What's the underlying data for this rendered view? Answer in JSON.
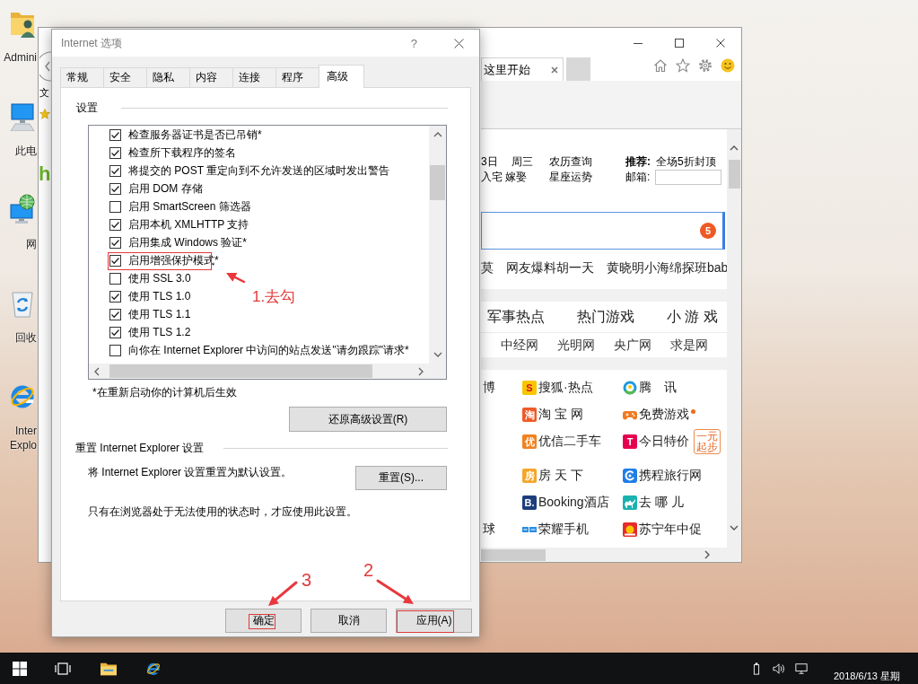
{
  "desktop": {
    "icons": [
      {
        "kind": "user-folder",
        "label": "Admini"
      },
      {
        "kind": "computer",
        "label": "此电"
      },
      {
        "kind": "network",
        "label": "网"
      },
      {
        "kind": "recycle-bin",
        "label": "回收"
      },
      {
        "kind": "browser",
        "label": "Inter Explo"
      }
    ]
  },
  "browser": {
    "menu_fragment": "文",
    "logo_fragment": "h",
    "tabs": [
      {
        "label": "这里开始",
        "selected": true
      }
    ],
    "info": {
      "date": "3日",
      "weekday": "周三",
      "lunar": "农历查询",
      "almanac": "入宅 嫁娶",
      "horoscope": "星座运势",
      "recommend_label": "推荐:",
      "recommend": "全场5折封顶",
      "mail_label": "邮箱:"
    },
    "search": {
      "badge": "5"
    },
    "hot_searches": [
      "莫",
      "网友爆料胡一天",
      "黄晓明小海绵探班bab"
    ],
    "categories": [
      "军事热点",
      "热门游戏",
      "小 游 戏"
    ],
    "media_links": [
      "中经网",
      "光明网",
      "央广网",
      "求是网"
    ],
    "site_rows": [
      {
        "fragment": "博",
        "items": [
          {
            "kind": "sohu",
            "icon_text": "S",
            "label": "搜狐·热点",
            "dot": false
          },
          {
            "kind": "tencent",
            "label": "腾　讯",
            "dot": false
          }
        ]
      },
      {
        "items": [
          {
            "kind": "taobao",
            "icon_text": "淘",
            "label": "淘 宝 网",
            "dot": false
          },
          {
            "kind": "game",
            "label": "免费游戏",
            "dot": true
          }
        ]
      },
      {
        "items": [
          {
            "kind": "youxin",
            "icon_text": "优",
            "label": "优信二手车",
            "dot": false
          },
          {
            "kind": "tmall",
            "icon_text": "T",
            "label": "今日特价",
            "badge": "一元起步",
            "dot": false
          }
        ]
      },
      {
        "items": [
          {
            "kind": "fang",
            "icon_text": "房",
            "label": "房 天 下",
            "dot": false
          },
          {
            "kind": "ctrip",
            "label": "携程旅行网",
            "dot": false
          }
        ]
      },
      {
        "items": [
          {
            "kind": "booking",
            "icon_text": "B.",
            "label": "Booking酒店",
            "dot": false
          },
          {
            "kind": "qunar",
            "label": "去 哪 儿",
            "dot": false
          }
        ]
      },
      {
        "fragment": "球",
        "items": [
          {
            "kind": "honor",
            "label": "荣耀手机",
            "dot": false
          },
          {
            "kind": "suning",
            "label": "苏宁年中促",
            "dot": false
          }
        ]
      }
    ]
  },
  "dialog": {
    "title": "Internet 选项",
    "help": "?",
    "tabs": [
      {
        "label": "常规",
        "selected": false
      },
      {
        "label": "安全",
        "selected": false
      },
      {
        "label": "隐私",
        "selected": false
      },
      {
        "label": "内容",
        "selected": false
      },
      {
        "label": "连接",
        "selected": false
      },
      {
        "label": "程序",
        "selected": false
      },
      {
        "label": "高级",
        "selected": true
      }
    ],
    "settings_group": "设置",
    "options": [
      {
        "label": "检查服务器证书是否已吊销*",
        "checked": true,
        "highlighted": false
      },
      {
        "label": "检查所下载程序的签名",
        "checked": true,
        "highlighted": false
      },
      {
        "label": "将提交的 POST 重定向到不允许发送的区域时发出警告",
        "checked": true,
        "highlighted": false
      },
      {
        "label": "启用 DOM 存储",
        "checked": true,
        "highlighted": false
      },
      {
        "label": "启用 SmartScreen 筛选器",
        "checked": false,
        "highlighted": false
      },
      {
        "label": "启用本机 XMLHTTP 支持",
        "checked": true,
        "highlighted": false
      },
      {
        "label": "启用集成 Windows 验证*",
        "checked": true,
        "highlighted": false
      },
      {
        "label": "启用增强保护模式*",
        "checked": true,
        "highlighted": true
      },
      {
        "label": "使用 SSL 3.0",
        "checked": false,
        "highlighted": false
      },
      {
        "label": "使用 TLS 1.0",
        "checked": true,
        "highlighted": false
      },
      {
        "label": "使用 TLS 1.1",
        "checked": true,
        "highlighted": false
      },
      {
        "label": "使用 TLS 1.2",
        "checked": true,
        "highlighted": false
      },
      {
        "label": "向你在 Internet Explorer 中访问的站点发送\"请勿跟踪\"请求*",
        "checked": false,
        "highlighted": false
      }
    ],
    "restart_note": "*在重新启动你的计算机后生效",
    "restore_button": "还原高级设置(R)",
    "reset_group": "重置 Internet Explorer 设置",
    "reset_text": "将 Internet Explorer 设置重置为默认设置。",
    "reset_button": "重置(S)...",
    "reset_note": "只有在浏览器处于无法使用的状态时，才应使用此设置。",
    "buttons": [
      {
        "label": "确定",
        "highlighted": true
      },
      {
        "label": "取消",
        "highlighted": false
      },
      {
        "label": "应用(A)",
        "highlighted": true
      }
    ]
  },
  "annotations": [
    {
      "text": "1.去勾"
    },
    {
      "text": "2"
    },
    {
      "text": "3"
    }
  ],
  "taskbar": {
    "apps": [
      {
        "kind": "task-view"
      },
      {
        "kind": "file-explorer"
      },
      {
        "kind": "browser"
      }
    ],
    "clock": "2018/6/13 星期"
  }
}
